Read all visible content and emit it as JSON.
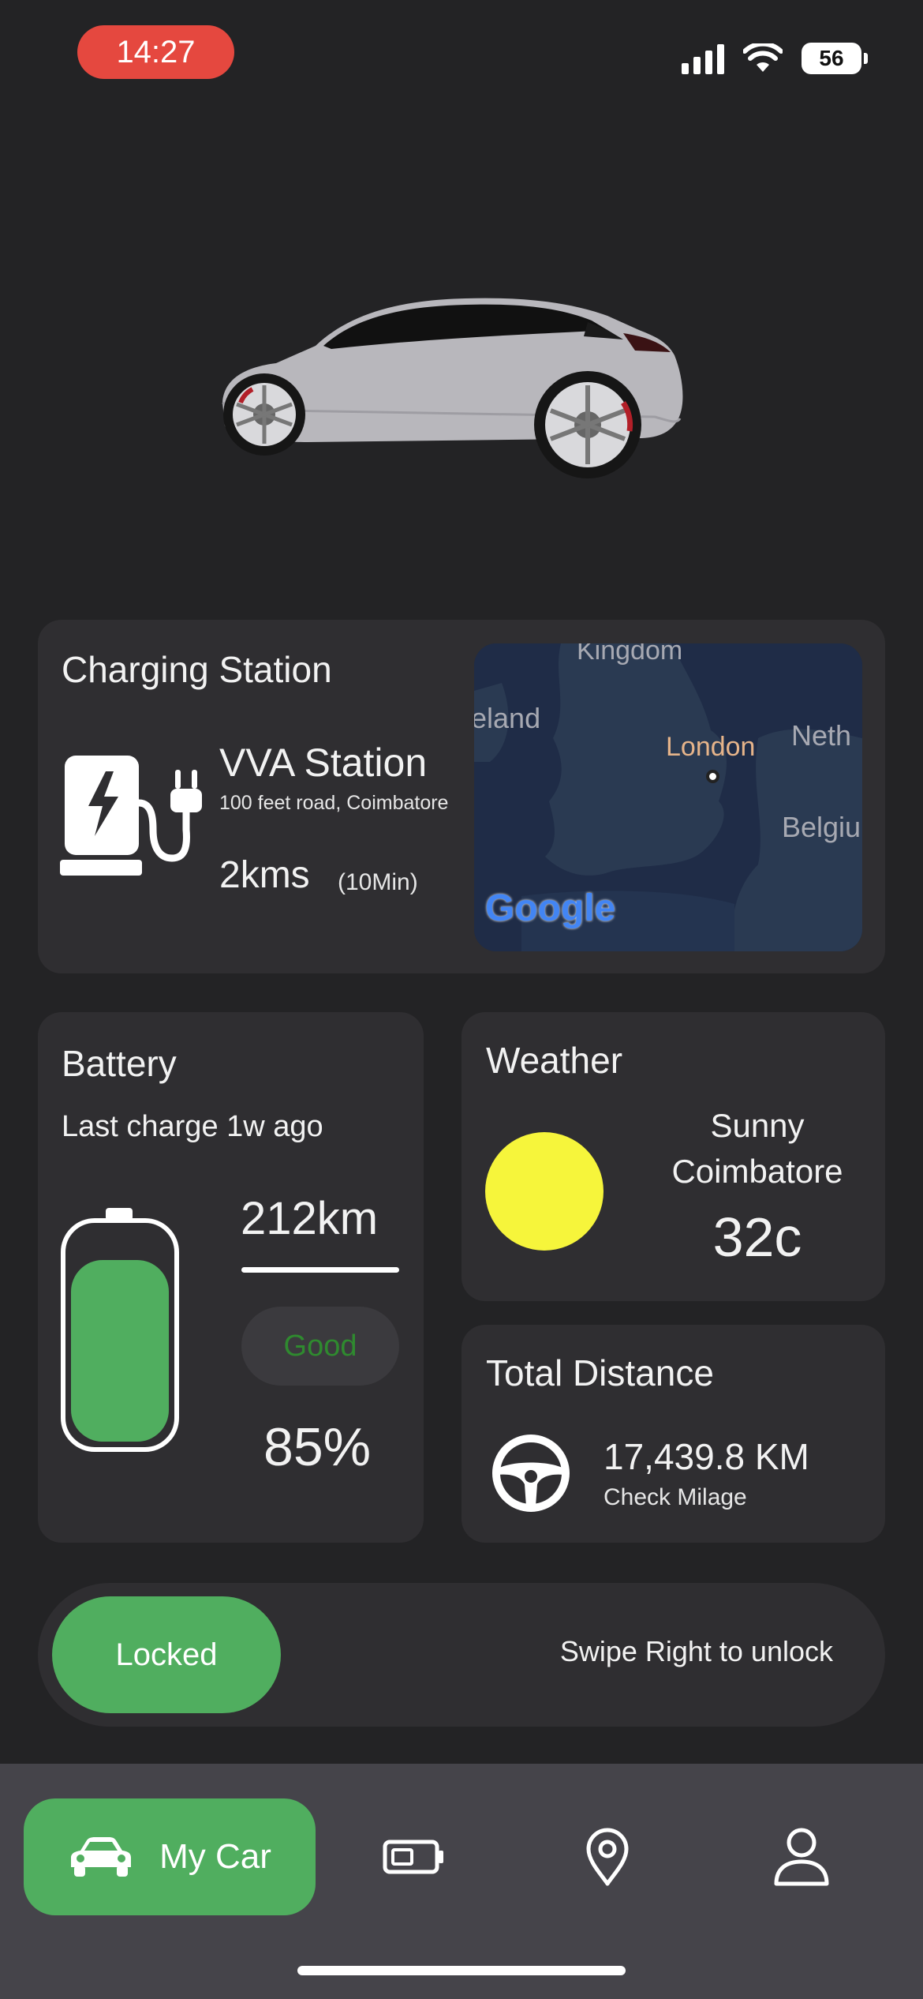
{
  "status_bar": {
    "time": "14:27",
    "battery_level": "56",
    "icons": [
      "signal-icon",
      "wifi-icon",
      "battery-icon"
    ]
  },
  "charging_station": {
    "title": "Charging Station",
    "icon": "ev-charger-icon",
    "name": "VVA Station",
    "address": "100 feet road, Coimbatore",
    "distance": "2kms",
    "eta": "(10Min)",
    "map": {
      "labels": [
        "Kingdom",
        "eland",
        "London",
        "Neth",
        "Belgiu"
      ],
      "provider": "Google"
    }
  },
  "battery": {
    "title": "Battery",
    "last_charge": "Last charge 1w ago",
    "range": "212km",
    "health": "Good",
    "percent_label": "85%",
    "level": 0.85
  },
  "weather": {
    "title": "Weather",
    "condition": "Sunny",
    "city": "Coimbatore",
    "temperature": "32c",
    "icon": "sun-icon"
  },
  "total_distance": {
    "title": "Total Distance",
    "value": "17,439.8 KM",
    "subtitle": "Check Milage",
    "icon": "steering-wheel-icon"
  },
  "lock_slider": {
    "state_label": "Locked",
    "hint": "Swipe Right to unlock"
  },
  "bottom_nav": {
    "items": [
      {
        "label": "My Car",
        "icon": "car-icon",
        "active": true
      },
      {
        "label": "",
        "icon": "battery-icon",
        "active": false
      },
      {
        "label": "",
        "icon": "location-pin-icon",
        "active": false
      },
      {
        "label": "",
        "icon": "profile-icon",
        "active": false
      }
    ]
  },
  "colors": {
    "background": "#232325",
    "card": "#2f2e31",
    "accent_green": "#50ae5f",
    "time_pill": "#e5483f",
    "sun": "#f6f53b",
    "nav_bg": "#45444a"
  }
}
